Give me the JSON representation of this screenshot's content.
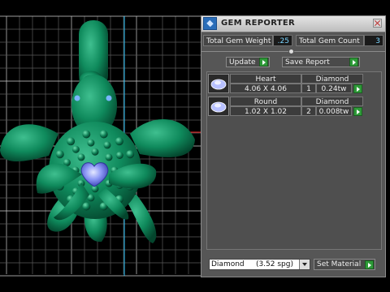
{
  "panel": {
    "title": "GEM REPORTER",
    "total_weight_label": "Total Gem Weight",
    "total_weight_value": ".25",
    "total_count_label": "Total Gem Count",
    "total_count_value": "3",
    "update_label": "Update",
    "save_report_label": "Save Report",
    "gems": [
      {
        "shape": "Heart",
        "size": "4.06 X 4.06",
        "type": "Diamond",
        "count": "1",
        "weight": "0.24tw"
      },
      {
        "shape": "Round",
        "size": "1.02 X 1.02",
        "type": "Diamond",
        "count": "2",
        "weight": "0.008tw"
      }
    ],
    "material_value": "Diamond     (3.52 spg)",
    "set_material_label": "Set Material"
  },
  "colors": {
    "model": "#0f8a5c",
    "gem": "#7f8df0",
    "grid": "#f0f0f0",
    "panel_bg": "#565656",
    "accent_button": "#2e9a38"
  }
}
